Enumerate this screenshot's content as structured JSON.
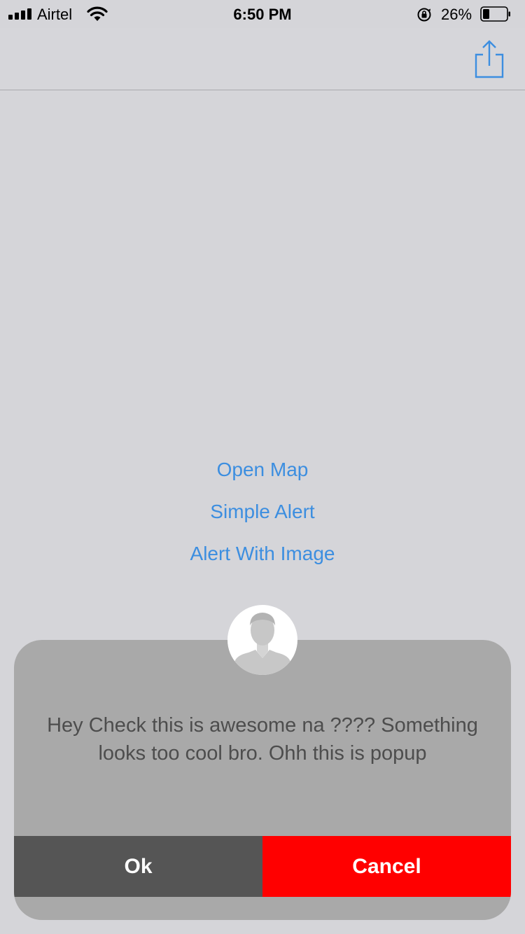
{
  "status_bar": {
    "carrier": "Airtel",
    "time": "6:50 PM",
    "battery_percent": "26%",
    "signal_icon": "signal-bars-icon",
    "wifi_icon": "wifi-icon",
    "orientation_lock_icon": "orientation-lock-icon",
    "battery_icon": "battery-icon",
    "battery_level": 0.26
  },
  "nav_bar": {
    "share_icon": "share-icon"
  },
  "menu": {
    "open_map": "Open Map",
    "simple_alert": "Simple Alert",
    "alert_with_image": "Alert With Image"
  },
  "popup": {
    "avatar_icon": "user-avatar-icon",
    "message": "Hey Check this is awesome na ???? Something looks too cool bro. Ohh this is popup",
    "ok_label": "Ok",
    "cancel_label": "Cancel"
  },
  "colors": {
    "link": "#3c8ee0",
    "popup_bg": "#a9a9a9",
    "ok_bg": "#555555",
    "cancel_bg": "#ff0000",
    "background": "#d5d5d9"
  }
}
